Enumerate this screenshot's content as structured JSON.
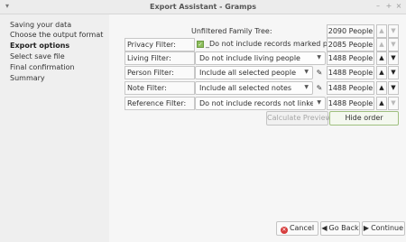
{
  "window": {
    "title": "Export Assistant - Gramps",
    "menu_glyph": "▾",
    "minimize_glyph": "–",
    "maximize_glyph": "+",
    "close_glyph": "×"
  },
  "sidebar": {
    "steps": [
      {
        "label": "Saving your data"
      },
      {
        "label": "Choose the output format"
      },
      {
        "label": "Export options"
      },
      {
        "label": "Select save file"
      },
      {
        "label": "Final confirmation"
      },
      {
        "label": "Summary"
      }
    ]
  },
  "options": {
    "tree_label": "Unfiltered Family Tree:",
    "tree_count": "2090 People",
    "privacy": {
      "label": "Privacy Filter:",
      "check": "✓",
      "text": "_Do not include records marked private",
      "count": "2085 People"
    },
    "living": {
      "label": "Living Filter:",
      "value": "Do not include living people",
      "count": "1488 People"
    },
    "person": {
      "label": "Person Filter:",
      "value": "Include all selected people",
      "count": "1488 People"
    },
    "note": {
      "label": "Note Filter:",
      "value": "Include all selected notes",
      "count": "1488 People"
    },
    "reference": {
      "label": "Reference Filter:",
      "value": "Do not include records not linked to ...",
      "count": "1488 People"
    },
    "up_glyph": "▲",
    "down_glyph": "▼",
    "combo_arrow": "▼",
    "edit_glyph": "✎",
    "calc_label": "Calculate Previews",
    "hide_label": "Hide order"
  },
  "footer": {
    "cancel_label": "Cancel",
    "cancel_glyph": "✕",
    "back_label": "Go Back",
    "back_glyph": "◀",
    "continue_label": "Continue",
    "continue_glyph": "▶"
  }
}
